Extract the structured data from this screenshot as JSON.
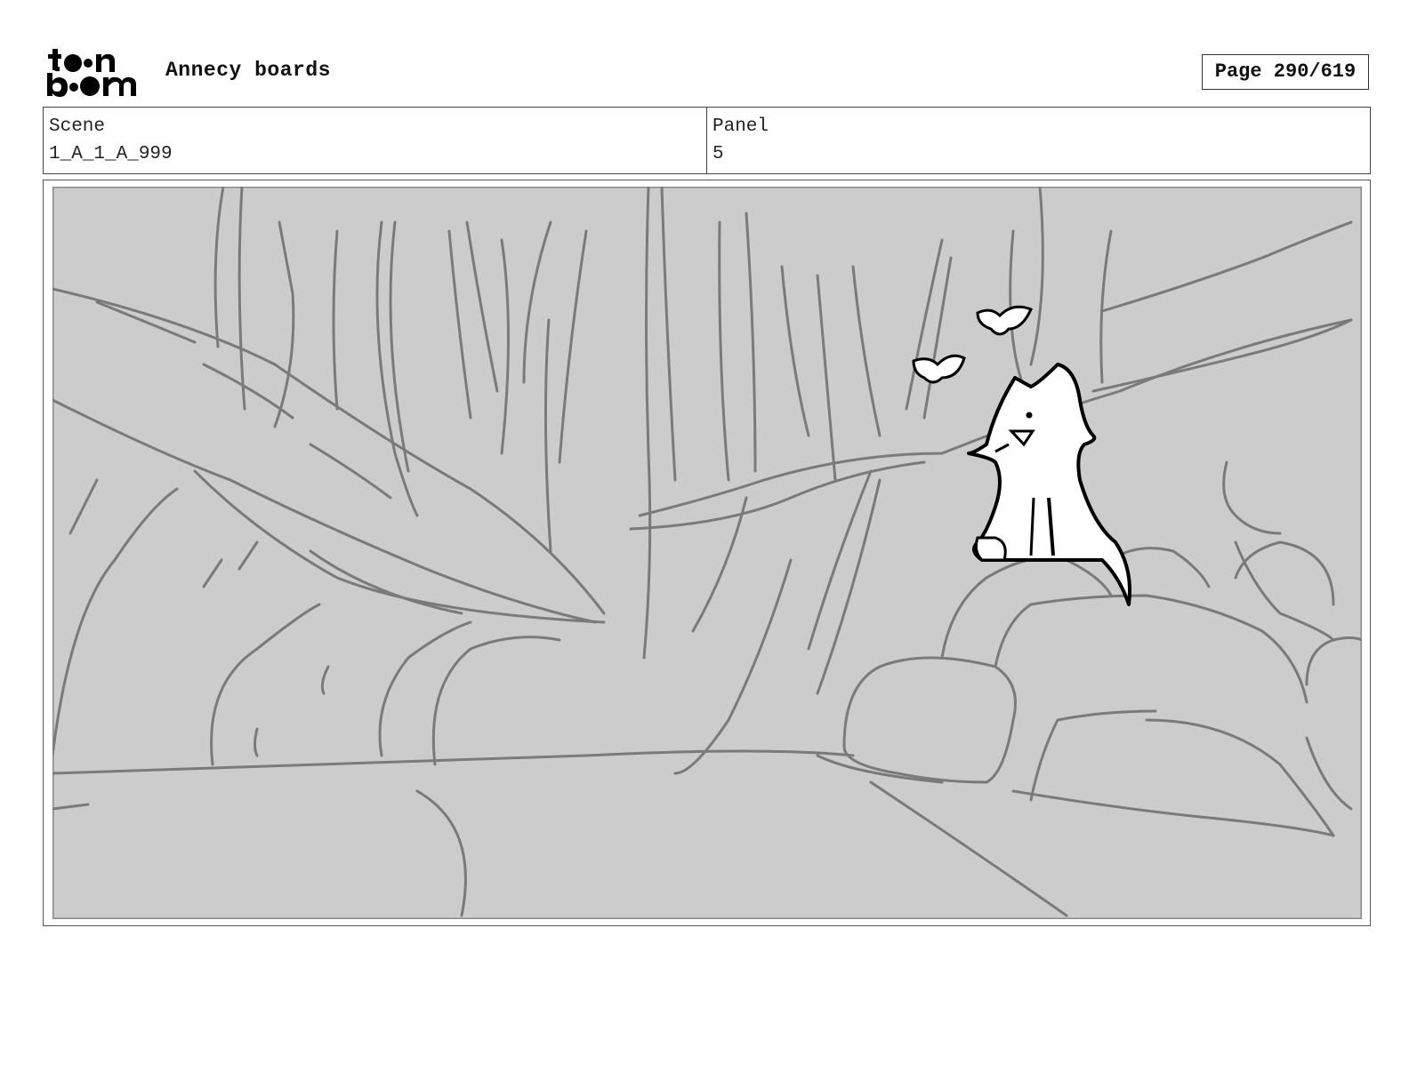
{
  "header": {
    "logo_text": "toon boom",
    "document_title": "Annecy boards",
    "page_indicator": "Page 290/619"
  },
  "info": {
    "scene_label": "Scene",
    "scene_value": "1_A_1_A_999",
    "panel_label": "Panel",
    "panel_value": "5"
  },
  "panel_image": {
    "description_icon": "storyboard-sketch-forest-fox-birds",
    "background_color": "#cccccc",
    "sketch_color": "#7a7a7a",
    "character_color": "#ffffff"
  }
}
